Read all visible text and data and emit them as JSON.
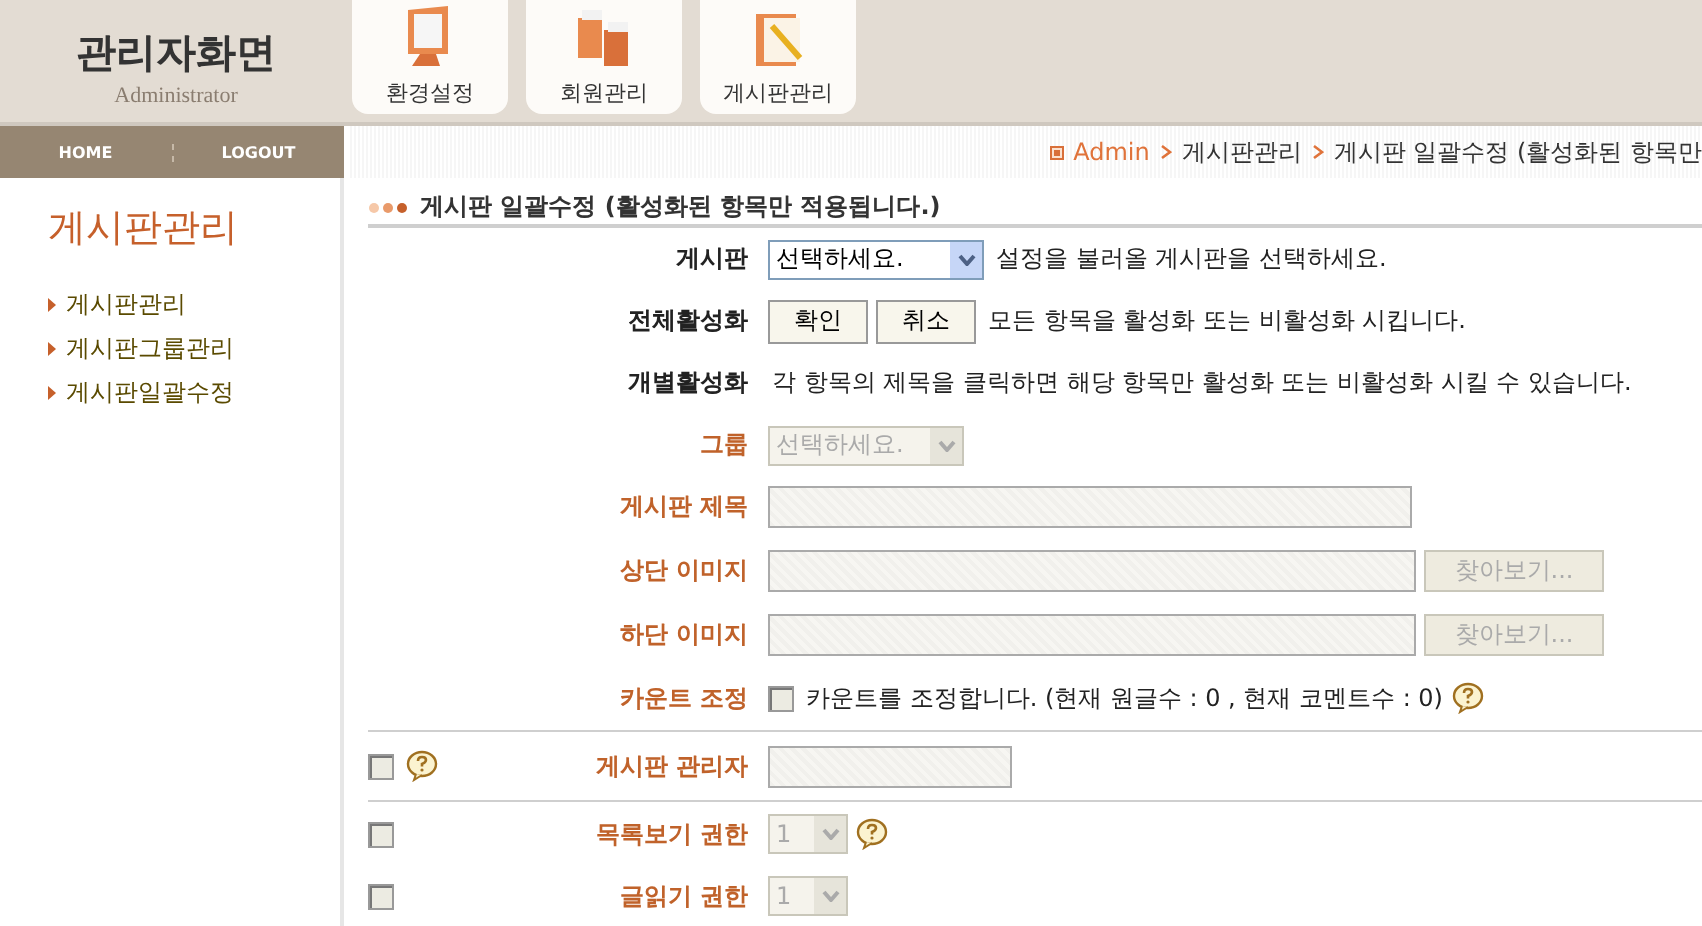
{
  "header": {
    "logo": "관리자화면",
    "logo_sub": "Administrator",
    "menu": [
      {
        "label": "환경설정"
      },
      {
        "label": "회원관리"
      },
      {
        "label": "게시판관리"
      }
    ]
  },
  "nav": [
    "HOME",
    "LOGOUT"
  ],
  "breadcrumb": [
    {
      "label": "Admin",
      "kind": "link"
    },
    {
      "label": "게시판관리",
      "kind": "text"
    },
    {
      "label": "게시판 일괄수정 (활성화된 항목만",
      "kind": "text"
    }
  ],
  "sidebar": {
    "title": "게시판관리",
    "items": [
      "게시판관리",
      "게시판그룹관리",
      "게시판일괄수정"
    ]
  },
  "form": {
    "title": "게시판 일괄수정 (활성화된 항목만 적용됩니다.)",
    "rows": [
      {
        "kind": "select",
        "label": "게시판",
        "active": true,
        "value": "선택하세요.",
        "hint": "설정을 불러올 게시판을 선택하세요."
      },
      {
        "kind": "buttons",
        "label": "전체활성화",
        "active": true,
        "buttons": [
          "확인",
          "취소"
        ],
        "hint": "모든 항목을 활성화 또는 비활성화 시킵니다."
      },
      {
        "kind": "text",
        "label": "개별활성화",
        "active": true,
        "hint": "각 항목의 제목을 클릭하면 해당 항목만 활성화 또는 비활성화 시킬 수 있습니다."
      },
      {
        "kind": "select",
        "label": "그룹",
        "active": false,
        "value": "선택하세요."
      },
      {
        "kind": "input",
        "label": "게시판 제목",
        "active": false
      },
      {
        "kind": "file",
        "label": "상단 이미지",
        "active": false,
        "button": "찾아보기..."
      },
      {
        "kind": "file",
        "label": "하단 이미지",
        "active": false,
        "button": "찾아보기..."
      },
      {
        "kind": "checkbox",
        "label": "카운트 조정",
        "active": false,
        "checked": false,
        "hint": "카운트를 조정합니다. (현재 원글수 : 0 , 현재 코멘트수 : 0)",
        "help": true
      },
      {
        "kind": "short_input",
        "label": "게시판 관리자",
        "active": false,
        "divider": true,
        "toggle": {
          "checked": false,
          "help": true
        }
      },
      {
        "kind": "small_select",
        "label": "목록보기 권한",
        "active": false,
        "value": "1",
        "help": true,
        "divider": true,
        "toggle": {
          "checked": false,
          "help": false
        }
      },
      {
        "kind": "small_select",
        "label": "글읽기 권한",
        "active": false,
        "value": "1",
        "toggle": {
          "checked": false,
          "help": false
        }
      }
    ]
  }
}
